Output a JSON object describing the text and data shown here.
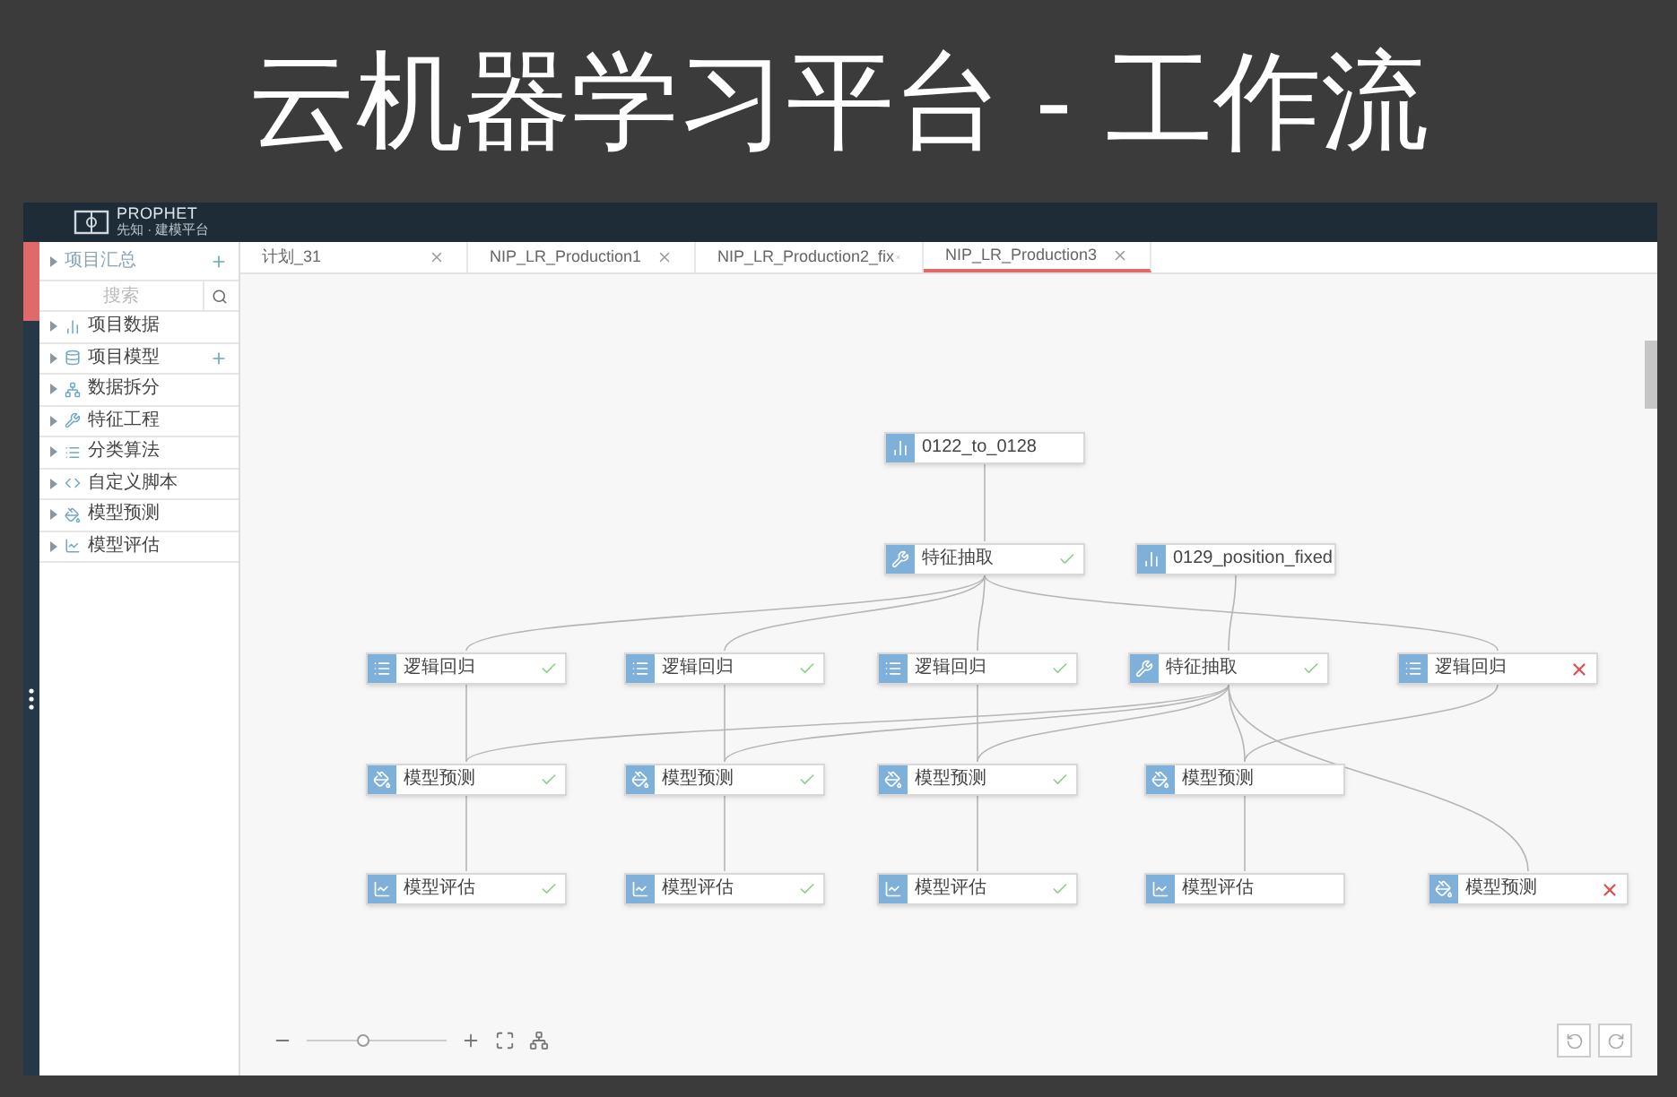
{
  "slide_title": "云机器学习平台 - 工作流",
  "app": {
    "logo_name": "PROPHET",
    "logo_subtitle": "先知 · 建模平台"
  },
  "sidebar": {
    "header": "项目汇总",
    "search": {
      "placeholder": "搜索"
    },
    "items": [
      {
        "label": "项目数据",
        "kind": "data",
        "add_button": false
      },
      {
        "label": "项目模型",
        "kind": "model",
        "add_button": true
      },
      {
        "label": "数据拆分",
        "kind": "split",
        "add_button": false
      },
      {
        "label": "特征工程",
        "kind": "feature",
        "add_button": false
      },
      {
        "label": "分类算法",
        "kind": "algorithm",
        "add_button": false
      },
      {
        "label": "自定义脚本",
        "kind": "script",
        "add_button": false
      },
      {
        "label": "模型预测",
        "kind": "predict",
        "add_button": false
      },
      {
        "label": "模型评估",
        "kind": "evaluate",
        "add_button": false
      }
    ]
  },
  "tabs": [
    {
      "label": "计划_31",
      "selected": false
    },
    {
      "label": "NIP_LR_Production1",
      "selected": false
    },
    {
      "label": "NIP_LR_Production2_fix",
      "selected": false
    },
    {
      "label": "NIP_LR_Production3",
      "selected": true
    }
  ],
  "workflow": {
    "nodes": [
      {
        "label": "0122_to_0128",
        "kind": "data",
        "succeeded": false,
        "failed": false
      },
      {
        "label": "特征抽取",
        "kind": "feature",
        "succeeded": true,
        "failed": false
      },
      {
        "label": "0129_position_fixed",
        "kind": "data",
        "succeeded": false,
        "failed": false
      },
      {
        "label": "逻辑回归",
        "kind": "algorithm",
        "succeeded": true,
        "failed": false
      },
      {
        "label": "逻辑回归",
        "kind": "algorithm",
        "succeeded": true,
        "failed": false
      },
      {
        "label": "逻辑回归",
        "kind": "algorithm",
        "succeeded": true,
        "failed": false
      },
      {
        "label": "特征抽取",
        "kind": "feature",
        "succeeded": true,
        "failed": false
      },
      {
        "label": "逻辑回归",
        "kind": "algorithm",
        "succeeded": false,
        "failed": true
      },
      {
        "label": "模型预测",
        "kind": "predict",
        "succeeded": true,
        "failed": false
      },
      {
        "label": "模型预测",
        "kind": "predict",
        "succeeded": true,
        "failed": false
      },
      {
        "label": "模型预测",
        "kind": "predict",
        "succeeded": true,
        "failed": false
      },
      {
        "label": "模型预测",
        "kind": "predict",
        "succeeded": false,
        "failed": false
      },
      {
        "label": "模型评估",
        "kind": "evaluate",
        "succeeded": true,
        "failed": false
      },
      {
        "label": "模型评估",
        "kind": "evaluate",
        "succeeded": true,
        "failed": false
      },
      {
        "label": "模型评估",
        "kind": "evaluate",
        "succeeded": true,
        "failed": false
      },
      {
        "label": "模型评估",
        "kind": "evaluate",
        "succeeded": false,
        "failed": false
      },
      {
        "label": "模型预测",
        "kind": "predict",
        "succeeded": false,
        "failed": true
      }
    ]
  },
  "zoom": {
    "level": 0.4
  }
}
